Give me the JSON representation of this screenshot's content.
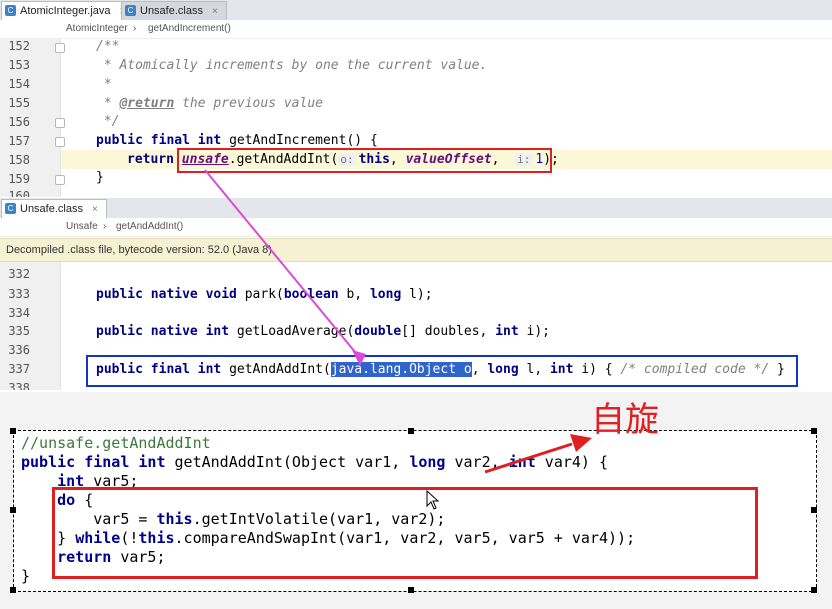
{
  "editor_top": {
    "tabs": [
      {
        "label": "AtomicInteger.java",
        "icon": "c-class-icon"
      },
      {
        "label": "Unsafe.class",
        "icon": "c-class-icon"
      }
    ],
    "breadcrumb": [
      "AtomicInteger",
      "getAndIncrement()"
    ],
    "lines": [
      "152",
      "153",
      "154",
      "155",
      "156",
      "157",
      "158",
      "159",
      "160"
    ]
  },
  "editor_bottom": {
    "tabs": [
      {
        "label": "Unsafe.class",
        "icon": "c-class-icon"
      }
    ],
    "breadcrumb": [
      "Unsafe",
      "getAndAddInt()"
    ],
    "status": "Decompiled .class file, bytecode version: 52.0 (Java 8)",
    "lines": [
      "332",
      "333",
      "334",
      "335",
      "336",
      "337",
      "338"
    ]
  },
  "code_top": {
    "l152": "/**",
    "l153": " * Atomically increments by one the current value.",
    "l154": " *",
    "l155_tag": "@return",
    "l155_text": " the previous value",
    "l156": " */",
    "l157_kw": "public final int ",
    "l157_rest": "getAndIncrement() {",
    "l158_kw": "return ",
    "l158_unsafe": "unsafe",
    "l158_call": ".getAndAddInt(",
    "l158_hint1": "o:",
    "l158_this": "this",
    "l158_comma": ", ",
    "l158_offset": "valueOffset",
    "l158_comma2": ",  ",
    "l158_hint2": "i:",
    "l158_one": "1",
    "l158_end": ");",
    "l159": "}"
  },
  "code_bottom": {
    "l333_kw": "public native void ",
    "l333_name": "park(",
    "l333_kw2": "boolean",
    "l333_mid": " b, ",
    "l333_kw3": "long",
    "l333_end": " l);",
    "l335_kw": "public native int ",
    "l335_name": "getLoadAverage(",
    "l335_kw2": "double",
    "l335_mid": "[] doubles, ",
    "l335_kw3": "int",
    "l335_end": " i);",
    "l337_kw": "public final int ",
    "l337_name": "getAndAddInt(",
    "l337_sel": "java.lang.Object o",
    "l337_mid": ", ",
    "l337_kw2": "long",
    "l337_mid2": " l, ",
    "l337_kw3": "int",
    "l337_mid3": " i) { ",
    "l337_cm": "/* compiled code */",
    "l337_end": " }"
  },
  "snippet": {
    "comment": "//unsafe.getAndAddInt",
    "sig_kw": "public final int ",
    "sig_name": "getAndAddInt(Object var1, ",
    "sig_long": "long",
    "sig_mid": " var2, ",
    "sig_int": "int",
    "sig_end": " var4) {",
    "decl_int": "int",
    "decl_rest": " var5;",
    "do_kw": "do",
    "do_rest": " {",
    "body_pre": "    var5 = ",
    "body_this": "this",
    "body_rest": ".getIntVolatile(var1, var2);",
    "while_pre": "} ",
    "while_kw": "while",
    "while_mid": "(!",
    "while_this": "this",
    "while_rest": ".compareAndSwapInt(var1, var2, var5, var5 + var4));",
    "return_kw": "return",
    "return_rest": " var5;",
    "close": "}"
  },
  "annotation": {
    "label": "自旋",
    "color": "#e02020"
  },
  "colors": {
    "red_box": "#e02020",
    "blue_box": "#1234c8",
    "arrow": "#d94bd9",
    "selection": "#2f65ca"
  }
}
